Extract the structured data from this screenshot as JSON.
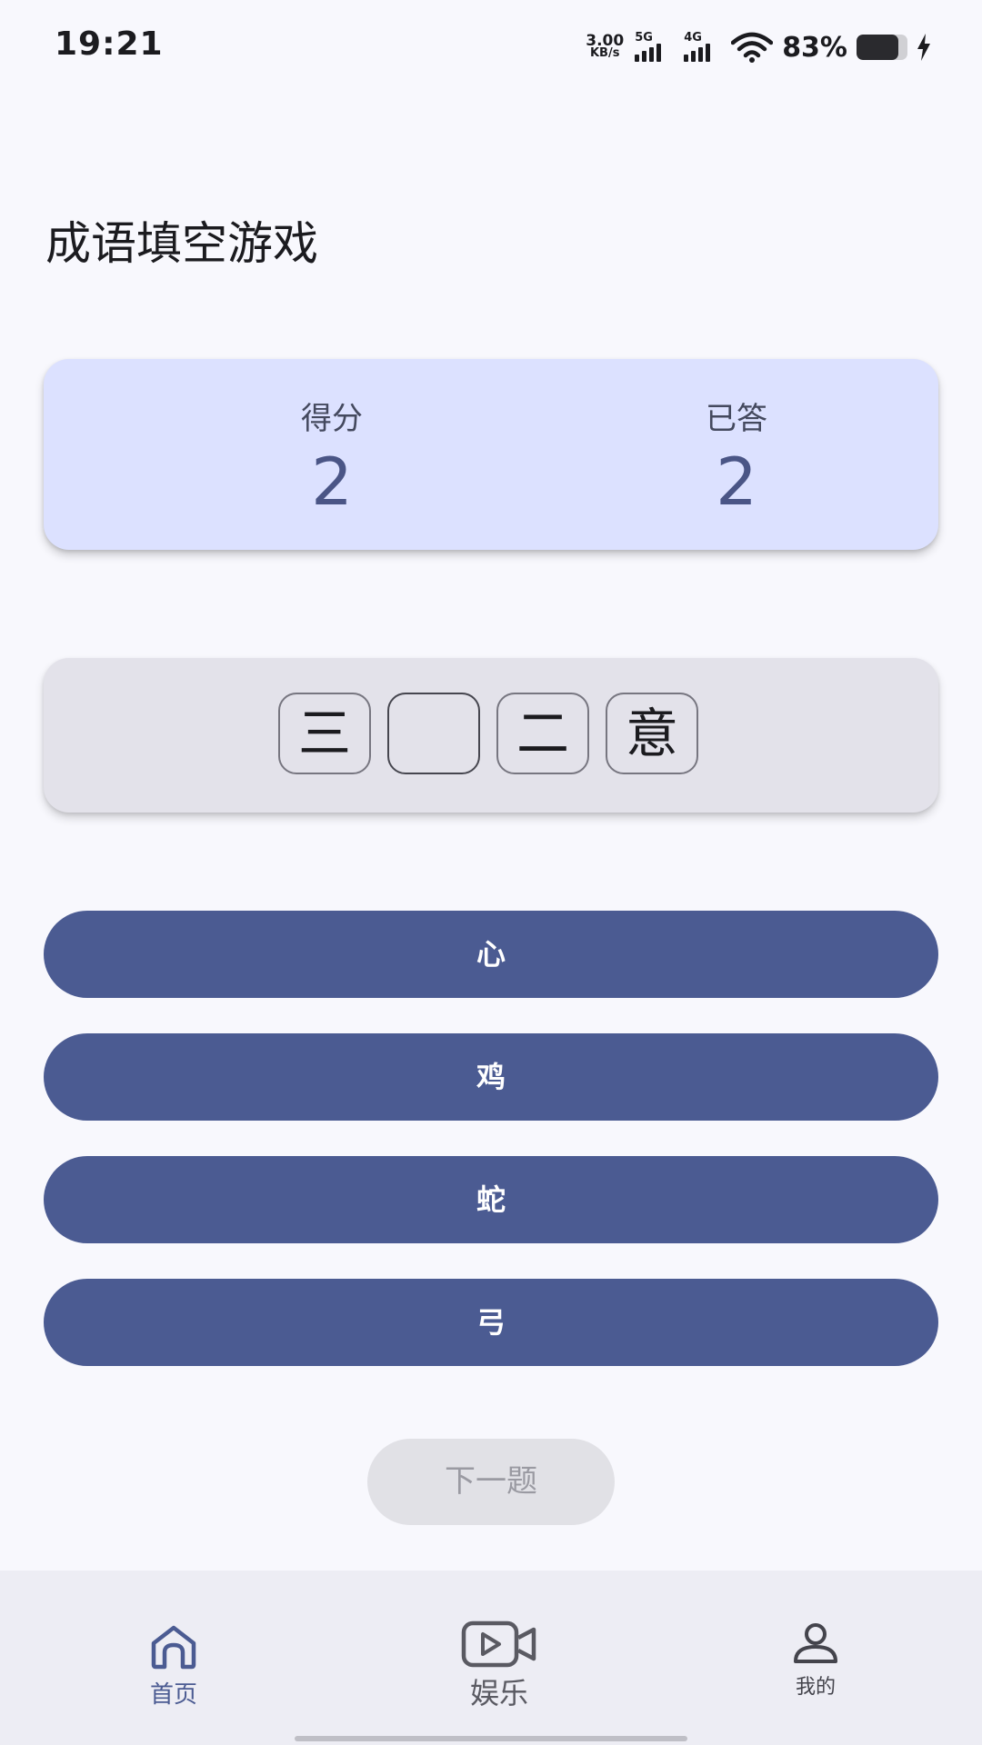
{
  "status_bar": {
    "time": "19:21",
    "net_speed_value": "3.00",
    "net_speed_unit": "KB/s",
    "sim1_label": "5G",
    "sim2_label": "4G",
    "battery_percent": "83%",
    "battery_level": 0.83,
    "charging": true,
    "icons": [
      "signal-5g-icon",
      "signal-4g-icon",
      "wifi-icon",
      "battery-icon",
      "charging-bolt-icon"
    ]
  },
  "page": {
    "title": "成语填空游戏"
  },
  "stats": {
    "score_label": "得分",
    "score_value": "2",
    "answered_label": "已答",
    "answered_value": "2"
  },
  "idiom": {
    "chars": [
      "三",
      "",
      "二",
      "意"
    ]
  },
  "options": [
    "心",
    "鸡",
    "蛇",
    "弓"
  ],
  "next_button": {
    "label": "下一题"
  },
  "bottom_nav": {
    "items": [
      {
        "label": "首页",
        "icon": "home-icon",
        "active": true
      },
      {
        "label": "娱乐",
        "icon": "video-icon",
        "active": false
      },
      {
        "label": "我的",
        "icon": "user-icon",
        "active": false
      }
    ]
  },
  "colors": {
    "background": "#f8f8fd",
    "score_card": "#dce1ff",
    "idiom_card": "#e3e2ea",
    "primary": "#4b5b92",
    "next_disabled": "#e1e1e6",
    "nav_background": "#ededf4"
  }
}
